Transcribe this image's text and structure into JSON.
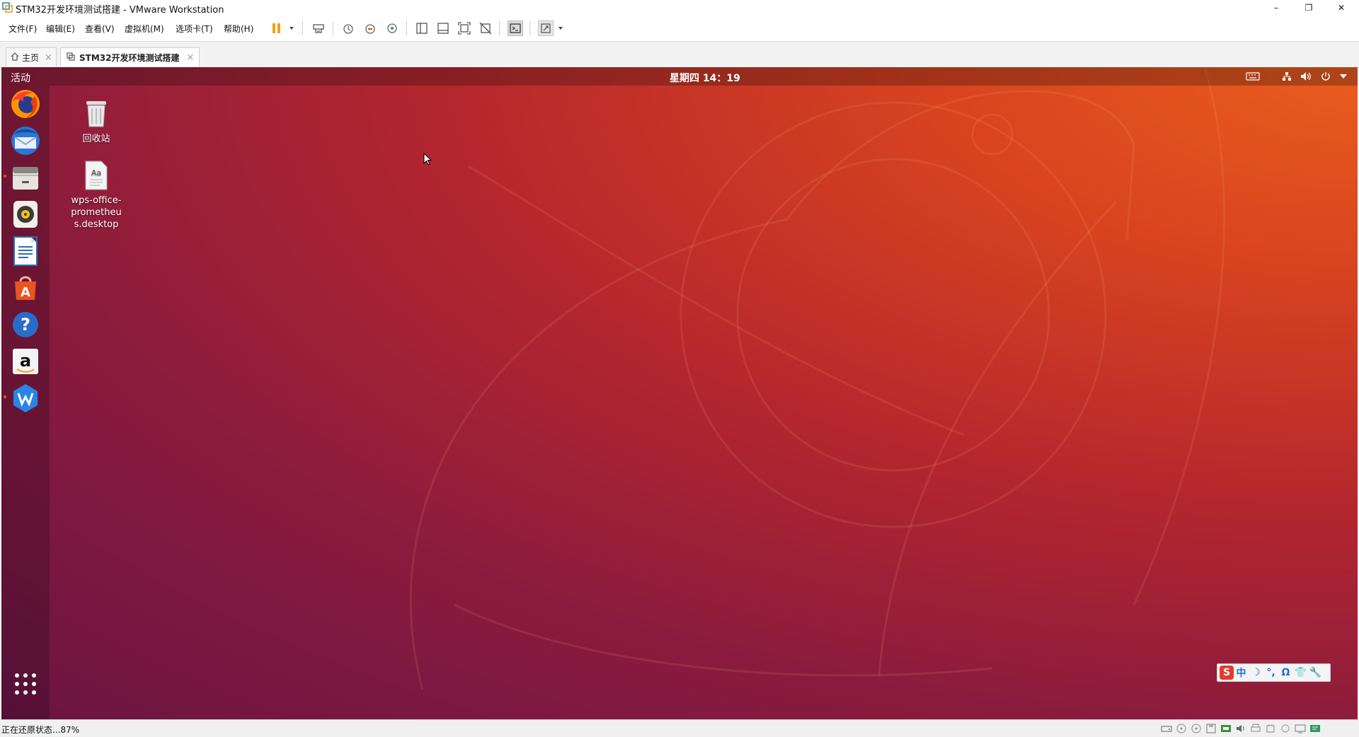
{
  "window": {
    "title": "STM32开发环境测试搭建 - VMware Workstation",
    "controls": {
      "minimize": "–",
      "restore": "❐",
      "close": "✕"
    }
  },
  "menu": {
    "items": [
      "文件(F)",
      "编辑(E)",
      "查看(V)",
      "虚拟机(M)",
      "选项卡(T)",
      "帮助(H)"
    ]
  },
  "toolbar": {
    "icons": [
      "pause-icon",
      "send-ctrl-alt-del-icon",
      "snapshot-icon",
      "revert-snapshot-icon",
      "snapshot-manager-icon",
      "show-library-icon",
      "thumbnail-bar-icon",
      "full-screen-icon",
      "unity-icon",
      "console-view-icon",
      "autofit-icon"
    ]
  },
  "tabs": [
    {
      "label": "主页",
      "active": false,
      "close": "×"
    },
    {
      "label": "STM32开发环境测试搭建",
      "active": true,
      "close": "×"
    }
  ],
  "guest": {
    "topbar": {
      "activities": "活动",
      "clock": "星期四 14：19"
    },
    "dock": [
      {
        "name": "firefox",
        "running": true
      },
      {
        "name": "thunderbird",
        "running": false
      },
      {
        "name": "files",
        "running": false
      },
      {
        "name": "rhythmbox",
        "running": false
      },
      {
        "name": "libreoffice-writer",
        "running": false
      },
      {
        "name": "ubuntu-software",
        "running": false
      },
      {
        "name": "help",
        "running": false
      },
      {
        "name": "amazon",
        "running": false
      },
      {
        "name": "wps-office",
        "running": true
      }
    ],
    "desktop_icons": [
      {
        "label": "回收站"
      },
      {
        "label": "wps-office-prometheus.desktop",
        "lines": [
          "wps-office-",
          "prometheu",
          "s.desktop"
        ]
      }
    ],
    "ime": {
      "logo": "S",
      "items": [
        "中",
        "☽",
        "°,",
        "Ω",
        "👕",
        "🔧"
      ]
    },
    "colors": {
      "accent": "#e95420",
      "topbar_text": "#ffffff"
    }
  },
  "status": {
    "text": "正在还原状态...87%"
  }
}
